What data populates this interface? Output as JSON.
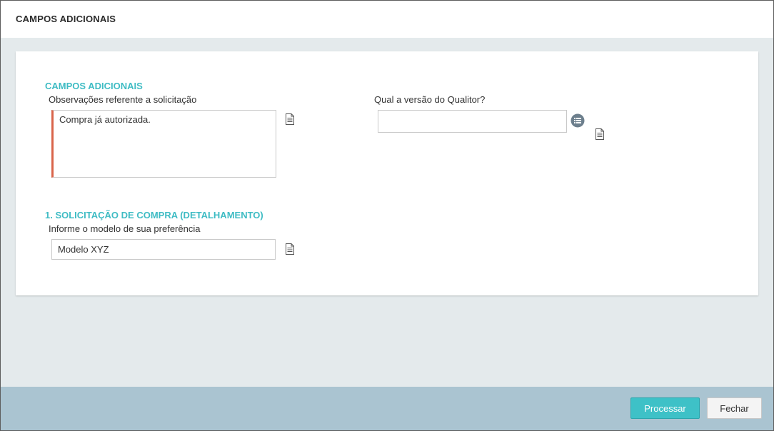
{
  "dialog": {
    "title": "CAMPOS ADICIONAIS"
  },
  "sections": [
    {
      "title": "CAMPOS ADICIONAIS",
      "fields": [
        {
          "label": "Observações referente a solicitação",
          "value": "Compra já autorizada.",
          "icon": "document-icon"
        },
        {
          "label": "Qual a versão do Qualitor?",
          "value": "",
          "icons": [
            "list-icon",
            "document-icon"
          ]
        }
      ]
    },
    {
      "title": "1. SOLICITAÇÃO DE COMPRA (DETALHAMENTO)",
      "fields": [
        {
          "label": "Informe o modelo de sua preferência",
          "value": "Modelo XYZ",
          "icon": "document-icon"
        }
      ]
    }
  ],
  "footer": {
    "process_label": "Processar",
    "close_label": "Fechar"
  },
  "colors": {
    "accent": "#3fbcc4",
    "required_bar": "#d9644a",
    "footer_bg": "#aac4d1",
    "primary_button": "#3ec1c7"
  }
}
